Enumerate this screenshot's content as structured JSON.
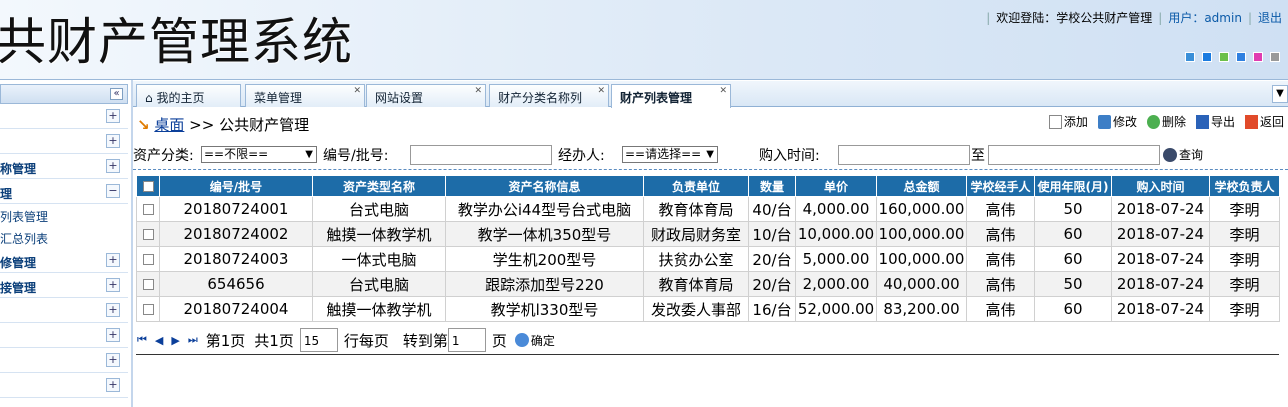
{
  "header": {
    "app_title": "共财产管理系统",
    "welcome": "欢迎登陆：学校公共财产管理",
    "user": "用户：admin",
    "logout": "退出",
    "theme_colors": [
      "#3a8fd8",
      "#1a7be0",
      "#6cc04a",
      "#2f80e0",
      "#e03cb0",
      "#9a9a9a"
    ]
  },
  "sidebar": {
    "collapse_glyph": "«",
    "rows": [
      {
        "label": "",
        "sign": "+"
      },
      {
        "label": "",
        "sign": "+"
      },
      {
        "label": "称管理",
        "sign": "+"
      },
      {
        "label": "理",
        "sign": "−"
      }
    ],
    "subitems": [
      {
        "label": "列表管理"
      },
      {
        "label": "汇总列表"
      }
    ],
    "rows2": [
      {
        "label": "修管理",
        "sign": "+"
      },
      {
        "label": "接管理",
        "sign": "+"
      },
      {
        "label": "",
        "sign": "+"
      },
      {
        "label": "",
        "sign": "+"
      },
      {
        "label": "",
        "sign": "+"
      },
      {
        "label": "",
        "sign": "+"
      }
    ]
  },
  "tabs": [
    {
      "label": "我的主页",
      "icon": "home-icon"
    },
    {
      "label": "菜单管理"
    },
    {
      "label": "网站设置"
    },
    {
      "label": "财产分类名称列"
    },
    {
      "label": "财产列表管理"
    }
  ],
  "breadcrumb": {
    "home": "桌面",
    "sep": ">>",
    "current": "公共财产管理"
  },
  "toolbar": {
    "add": "添加",
    "edit": "修改",
    "delete": "删除",
    "export": "导出",
    "back": "返回"
  },
  "search": {
    "category_label": "资产分类:",
    "category_value": "==不限==",
    "number_label": "编号/批号:",
    "handler_label": "经办人:",
    "handler_value": "==请选择==",
    "date_label": "购入时间:",
    "to_label": "至",
    "query": "查询"
  },
  "table": {
    "columns": [
      "编号/批号",
      "资产类型名称",
      "资产名称信息",
      "负责单位",
      "数量",
      "单价",
      "总金额",
      "学校经手人",
      "使用年限(月)",
      "购入时间",
      "学校负责人"
    ],
    "rows": [
      [
        "20180724001",
        "台式电脑",
        "教学办公i44型号台式电脑",
        "教育体育局",
        "40/台",
        "4,000.00",
        "160,000.00",
        "高伟",
        "50",
        "2018-07-24",
        "李明"
      ],
      [
        "20180724002",
        "触摸一体教学机",
        "教学一体机350型号",
        "财政局财务室",
        "10/台",
        "10,000.00",
        "100,000.00",
        "高伟",
        "60",
        "2018-07-24",
        "李明"
      ],
      [
        "20180724003",
        "一体式电脑",
        "学生机200型号",
        "扶贫办公室",
        "20/台",
        "5,000.00",
        "100,000.00",
        "高伟",
        "60",
        "2018-07-24",
        "李明"
      ],
      [
        "654656",
        "台式电脑",
        "跟踪添加型号220",
        "教育体育局",
        "20/台",
        "2,000.00",
        "40,000.00",
        "高伟",
        "50",
        "2018-07-24",
        "李明"
      ],
      [
        "20180724004",
        "触摸一体教学机",
        "教学机l330型号",
        "发改委人事部",
        "16/台",
        "52,000.00",
        "83,200.00",
        "高伟",
        "60",
        "2018-07-24",
        "李明"
      ]
    ]
  },
  "pager": {
    "page_text": "第1页",
    "total_text": "共1页",
    "per_page": "15",
    "per_page_label": "行每页",
    "goto_label": "转到第",
    "goto_value": "1",
    "page_unit": "页",
    "confirm": "确定"
  }
}
